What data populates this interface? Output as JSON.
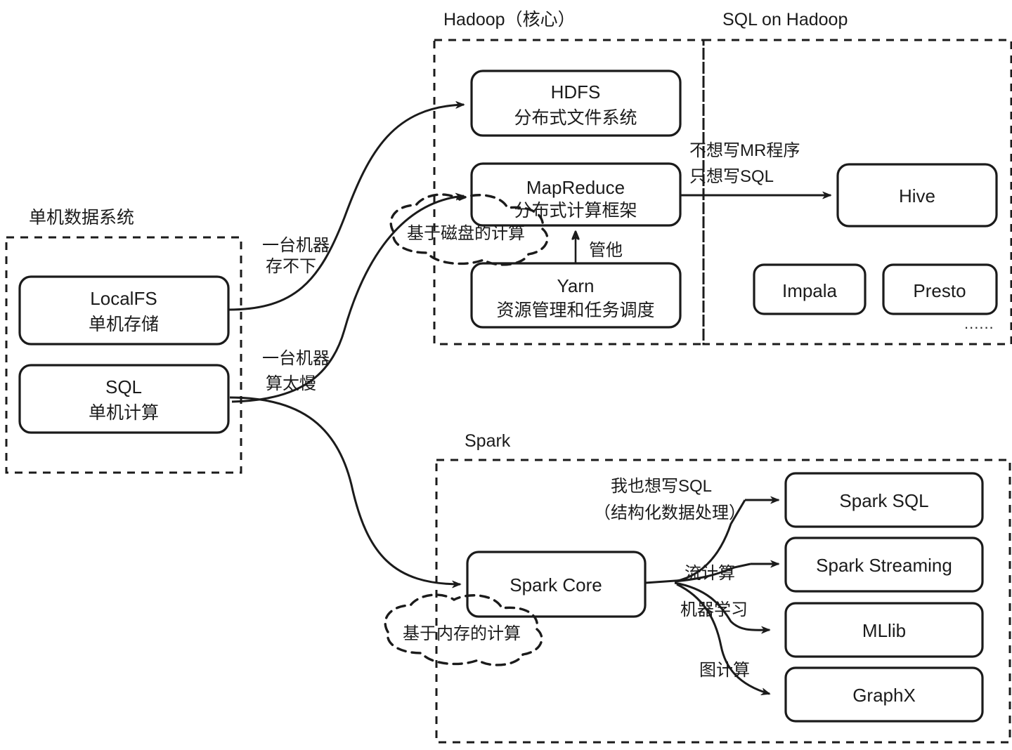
{
  "groups": {
    "local": {
      "label": "单机数据系统"
    },
    "hadoop": {
      "label": "Hadoop（核心）"
    },
    "sql_on_hadoop": {
      "label": "SQL on Hadoop"
    },
    "spark": {
      "label": "Spark"
    }
  },
  "nodes": {
    "localfs": {
      "title": "LocalFS",
      "subtitle": "单机存储"
    },
    "sql": {
      "title": "SQL",
      "subtitle": "单机计算"
    },
    "hdfs": {
      "title": "HDFS",
      "subtitle": "分布式文件系统"
    },
    "mapreduce": {
      "title": "MapReduce",
      "subtitle": "分布式计算框架"
    },
    "yarn": {
      "title": "Yarn",
      "subtitle": "资源管理和任务调度"
    },
    "hive": {
      "title": "Hive",
      "subtitle": ""
    },
    "impala": {
      "title": "Impala",
      "subtitle": ""
    },
    "presto": {
      "title": "Presto",
      "subtitle": ""
    },
    "spark_core": {
      "title": "Spark Core",
      "subtitle": ""
    },
    "spark_sql": {
      "title": "Spark SQL",
      "subtitle": ""
    },
    "spark_streaming": {
      "title": "Spark Streaming",
      "subtitle": ""
    },
    "mllib": {
      "title": "MLlib",
      "subtitle": ""
    },
    "graphx": {
      "title": "GraphX",
      "subtitle": ""
    }
  },
  "edge_labels": {
    "storage_limit_l1": "一台机器",
    "storage_limit_l2": "存不下",
    "compute_slow_l1": "一台机器",
    "compute_slow_l2": "算太慢",
    "yarn_manages": "管他",
    "no_mr_l1": "不想写MR程序",
    "no_mr_l2": "只想写SQL",
    "want_sql_l1": "我也想写SQL",
    "want_sql_l2": "（结构化数据处理）",
    "streaming": "流计算",
    "machine_learning": "机器学习",
    "graph_compute": "图计算"
  },
  "annotations": {
    "disk_based": "基于磁盘的计算",
    "memory_based": "基于内存的计算",
    "more_items": "......"
  },
  "colors": {
    "stroke": "#1b1b1b",
    "fill": "#ffffff",
    "background": "#ffffff"
  }
}
